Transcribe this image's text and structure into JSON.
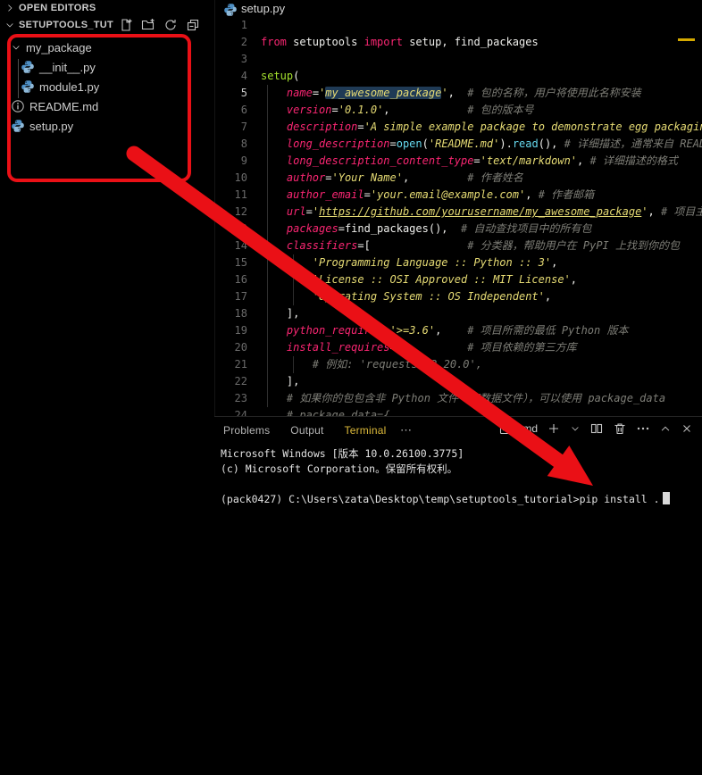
{
  "explorer": {
    "open_editors_label": "OPEN EDITORS",
    "section_title": "SETUPTOOLS_TUTO...",
    "tree": [
      {
        "label": "my_package",
        "type": "folder",
        "depth": 0,
        "expanded": true
      },
      {
        "label": "__init__.py",
        "type": "python",
        "depth": 1
      },
      {
        "label": "module1.py",
        "type": "python",
        "depth": 1
      },
      {
        "label": "README.md",
        "type": "info",
        "depth": 0
      },
      {
        "label": "setup.py",
        "type": "python",
        "depth": 0
      }
    ]
  },
  "editor": {
    "tab_label": "setup.py",
    "active_line": 5,
    "lines": [
      {
        "n": 1,
        "seg": []
      },
      {
        "n": 2,
        "seg": [
          {
            "x": "from",
            "s": "k"
          },
          {
            "x": " setuptools ",
            "s": "p"
          },
          {
            "x": "import",
            "s": "k"
          },
          {
            "x": " setup, find_packages",
            "s": "p"
          }
        ]
      },
      {
        "n": 3,
        "seg": []
      },
      {
        "n": 4,
        "seg": [
          {
            "x": "setup",
            "s": "f"
          },
          {
            "x": "(",
            "s": "p"
          }
        ]
      },
      {
        "n": 5,
        "seg": [
          {
            "x": "    ",
            "s": "p"
          },
          {
            "x": "name",
            "s": "a"
          },
          {
            "x": "=",
            "s": "p"
          },
          {
            "x": "'",
            "s": "s"
          },
          {
            "x": "my_awesome_package",
            "s": "h"
          },
          {
            "x": "'",
            "s": "s"
          },
          {
            "x": ",",
            "s": "p"
          },
          {
            "x": "  # 包的名称，用户将使用此名称安装",
            "s": "c"
          }
        ]
      },
      {
        "n": 6,
        "seg": [
          {
            "x": "    ",
            "s": "p"
          },
          {
            "x": "version",
            "s": "a"
          },
          {
            "x": "=",
            "s": "p"
          },
          {
            "x": "'0.1.0'",
            "s": "s"
          },
          {
            "x": ",",
            "s": "p"
          },
          {
            "x": "            # 包的版本号",
            "s": "c"
          }
        ]
      },
      {
        "n": 7,
        "seg": [
          {
            "x": "    ",
            "s": "p"
          },
          {
            "x": "description",
            "s": "a"
          },
          {
            "x": "=",
            "s": "p"
          },
          {
            "x": "'A simple example package to demonstrate egg packaging',",
            "s": "s"
          }
        ]
      },
      {
        "n": 8,
        "seg": [
          {
            "x": "    ",
            "s": "p"
          },
          {
            "x": "long_description",
            "s": "a"
          },
          {
            "x": "=",
            "s": "p"
          },
          {
            "x": "open",
            "s": "b"
          },
          {
            "x": "(",
            "s": "p"
          },
          {
            "x": "'README.md'",
            "s": "s"
          },
          {
            "x": ").",
            "s": "p"
          },
          {
            "x": "read",
            "s": "b"
          },
          {
            "x": "(), ",
            "s": "p"
          },
          {
            "x": "# 详细描述，通常来自 README",
            "s": "c"
          }
        ]
      },
      {
        "n": 9,
        "seg": [
          {
            "x": "    ",
            "s": "p"
          },
          {
            "x": "long_description_content_type",
            "s": "a"
          },
          {
            "x": "=",
            "s": "p"
          },
          {
            "x": "'text/markdown'",
            "s": "s"
          },
          {
            "x": ", ",
            "s": "p"
          },
          {
            "x": "# 详细描述的格式",
            "s": "c"
          }
        ]
      },
      {
        "n": 10,
        "seg": [
          {
            "x": "    ",
            "s": "p"
          },
          {
            "x": "author",
            "s": "a"
          },
          {
            "x": "=",
            "s": "p"
          },
          {
            "x": "'Your Name'",
            "s": "s"
          },
          {
            "x": ",",
            "s": "p"
          },
          {
            "x": "         # 作者姓名",
            "s": "c"
          }
        ]
      },
      {
        "n": 11,
        "seg": [
          {
            "x": "    ",
            "s": "p"
          },
          {
            "x": "author_email",
            "s": "a"
          },
          {
            "x": "=",
            "s": "p"
          },
          {
            "x": "'your.email@example.com'",
            "s": "s"
          },
          {
            "x": ", ",
            "s": "p"
          },
          {
            "x": "# 作者邮箱",
            "s": "c"
          }
        ]
      },
      {
        "n": 12,
        "seg": [
          {
            "x": "    ",
            "s": "p"
          },
          {
            "x": "url",
            "s": "a"
          },
          {
            "x": "=",
            "s": "p"
          },
          {
            "x": "'",
            "s": "s"
          },
          {
            "x": "https://github.com/yourusername/my_awesome_package",
            "s": "l"
          },
          {
            "x": "'",
            "s": "s"
          },
          {
            "x": ", ",
            "s": "p"
          },
          {
            "x": "# 项目主页",
            "s": "c"
          }
        ]
      },
      {
        "n": 13,
        "seg": [
          {
            "x": "    ",
            "s": "p"
          },
          {
            "x": "packages",
            "s": "a"
          },
          {
            "x": "=",
            "s": "p"
          },
          {
            "x": "find_packages",
            "s": "p"
          },
          {
            "x": "(),  ",
            "s": "p"
          },
          {
            "x": "# 自动查找项目中的所有包",
            "s": "c"
          }
        ]
      },
      {
        "n": 14,
        "seg": [
          {
            "x": "    ",
            "s": "p"
          },
          {
            "x": "classifiers",
            "s": "a"
          },
          {
            "x": "=[",
            "s": "p"
          },
          {
            "x": "               # 分类器，帮助用户在 PyPI 上找到你的包",
            "s": "c"
          }
        ]
      },
      {
        "n": 15,
        "seg": [
          {
            "x": "        ",
            "s": "p"
          },
          {
            "x": "'Programming Language :: Python :: 3'",
            "s": "s"
          },
          {
            "x": ",",
            "s": "p"
          }
        ]
      },
      {
        "n": 16,
        "seg": [
          {
            "x": "        ",
            "s": "p"
          },
          {
            "x": "'License :: OSI Approved :: MIT License'",
            "s": "s"
          },
          {
            "x": ",",
            "s": "p"
          }
        ]
      },
      {
        "n": 17,
        "seg": [
          {
            "x": "        ",
            "s": "p"
          },
          {
            "x": "'Operating System :: OS Independent'",
            "s": "s"
          },
          {
            "x": ",",
            "s": "p"
          }
        ]
      },
      {
        "n": 18,
        "seg": [
          {
            "x": "    ],",
            "s": "p"
          }
        ]
      },
      {
        "n": 19,
        "seg": [
          {
            "x": "    ",
            "s": "p"
          },
          {
            "x": "python_requires",
            "s": "a"
          },
          {
            "x": "=",
            "s": "p"
          },
          {
            "x": "'>=3.6'",
            "s": "s"
          },
          {
            "x": ",    ",
            "s": "p"
          },
          {
            "x": "# 项目所需的最低 Python 版本",
            "s": "c"
          }
        ]
      },
      {
        "n": 20,
        "seg": [
          {
            "x": "    ",
            "s": "p"
          },
          {
            "x": "install_requires",
            "s": "a"
          },
          {
            "x": "=[",
            "s": "p"
          },
          {
            "x": "          # 项目依赖的第三方库",
            "s": "c"
          }
        ]
      },
      {
        "n": 21,
        "seg": [
          {
            "x": "        ",
            "s": "p"
          },
          {
            "x": "# 例如: 'requests>=2.20.0',",
            "s": "c"
          }
        ]
      },
      {
        "n": 22,
        "seg": [
          {
            "x": "    ],",
            "s": "p"
          }
        ]
      },
      {
        "n": 23,
        "seg": [
          {
            "x": "    ",
            "s": "p"
          },
          {
            "x": "# 如果你的包包含非 Python 文件（如数据文件），可以使用 package_data",
            "s": "c"
          }
        ]
      },
      {
        "n": 24,
        "seg": [
          {
            "x": "    ",
            "s": "p"
          },
          {
            "x": "# package_data={",
            "s": "c"
          }
        ]
      }
    ]
  },
  "panel": {
    "tabs": [
      {
        "label": "Problems",
        "active": false
      },
      {
        "label": "Output",
        "active": false
      },
      {
        "label": "Terminal",
        "active": true
      }
    ],
    "more_label": "⋯",
    "shell_label": "cmd",
    "terminal_lines": [
      "Microsoft Windows [版本 10.0.26100.3775]",
      "(c) Microsoft Corporation。保留所有权利。",
      "",
      "(pack0427) C:\\Users\\zata\\Desktop\\temp\\setuptools_tutorial>pip install ."
    ],
    "cursor_on_last_line": true
  },
  "annotations": {
    "color": "#ea1016",
    "rectangle_target": "file tree (my_package project files)",
    "arrow_target": "terminal pip install command"
  }
}
